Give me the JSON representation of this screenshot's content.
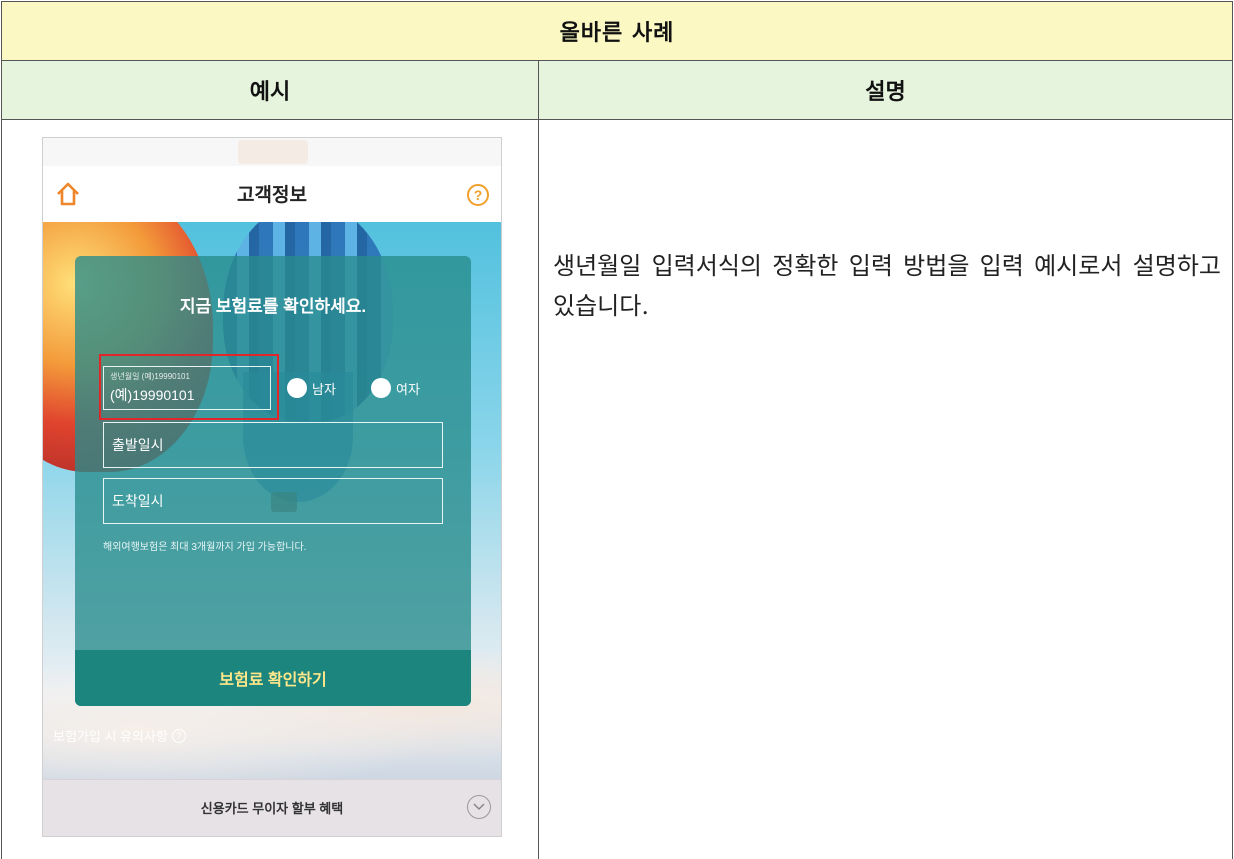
{
  "table": {
    "title": "올바른 사례",
    "col_example": "예시",
    "col_description": "설명",
    "description": "생년월일 입력서식의 정확한 입력 방법을 입력 예시로서 설명하고 있습니다."
  },
  "phone": {
    "app_title": "고객정보",
    "help_symbol": "?",
    "card_title": "지금 보험료를 확인하세요.",
    "birth_label": "생년월일 (예)19990101",
    "birth_value": "(예)19990101",
    "gender_male": "남자",
    "gender_female": "여자",
    "departure_placeholder": "출발일시",
    "arrival_placeholder": "도착일시",
    "note": "해외여행보험은 최대 3개월까지 가입 가능합니다.",
    "cta_label": "보험료 확인하기",
    "notice_label": "보험가입 시 유의사항",
    "bottom_label": "신용카드 무이자 할부 혜택",
    "accent": "#f0a02a",
    "highlight": "#e2262a"
  }
}
